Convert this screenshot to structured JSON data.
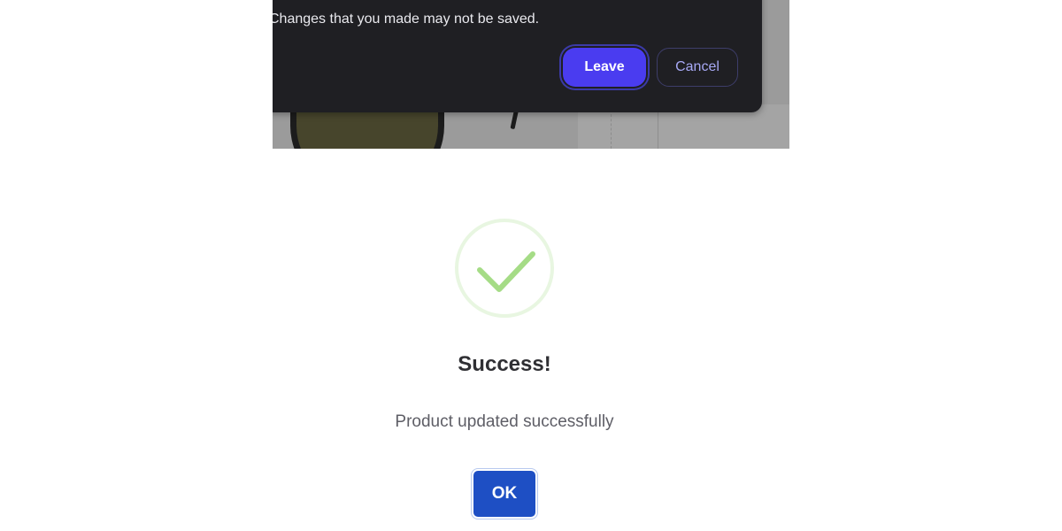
{
  "leave_dialog": {
    "message": "Changes that you made may not be saved.",
    "leave_label": "Leave",
    "cancel_label": "Cancel",
    "colors": {
      "background": "#1f1f23",
      "leave_button": "#4a3cf0",
      "cancel_text": "#a7a9f5"
    }
  },
  "success_modal": {
    "icon": "checkmark-icon",
    "title": "Success!",
    "message": "Product updated successfully",
    "ok_label": "OK",
    "colors": {
      "check": "#a5dc86",
      "ok_button": "#1e4fc4"
    }
  }
}
